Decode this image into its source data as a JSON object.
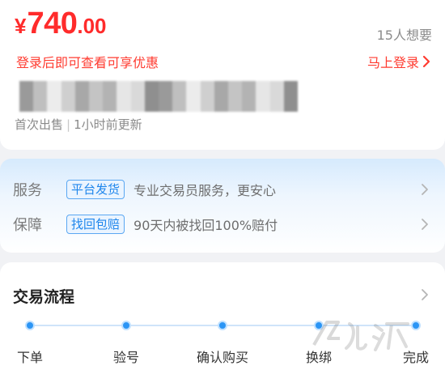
{
  "price": {
    "currency": "¥",
    "integer": "740",
    "decimal": ".00"
  },
  "wants": "15人想要",
  "promo": {
    "text": "登录后即可查看可享优惠",
    "login_label": "马上登录"
  },
  "listing": {
    "first_sale": "首次出售",
    "separator": "|",
    "updated": "1小时前更新"
  },
  "services": [
    {
      "label": "服务",
      "badge": "平台发货",
      "text": "专业交易员服务，更安心"
    },
    {
      "label": "保障",
      "badge": "找回包赔",
      "text": "90天内被找回100%赔付"
    }
  ],
  "process": {
    "title": "交易流程",
    "steps": [
      "下单",
      "验号",
      "确认购买",
      "换绑",
      "完成"
    ]
  },
  "colors": {
    "price_red": "#ff2b2b",
    "accent_blue": "#2b95f5"
  },
  "icons": {
    "login_chevron": "chevron-right-icon",
    "row_chevron": "chevron-right-icon",
    "watermark": "logo-watermark-icon"
  }
}
